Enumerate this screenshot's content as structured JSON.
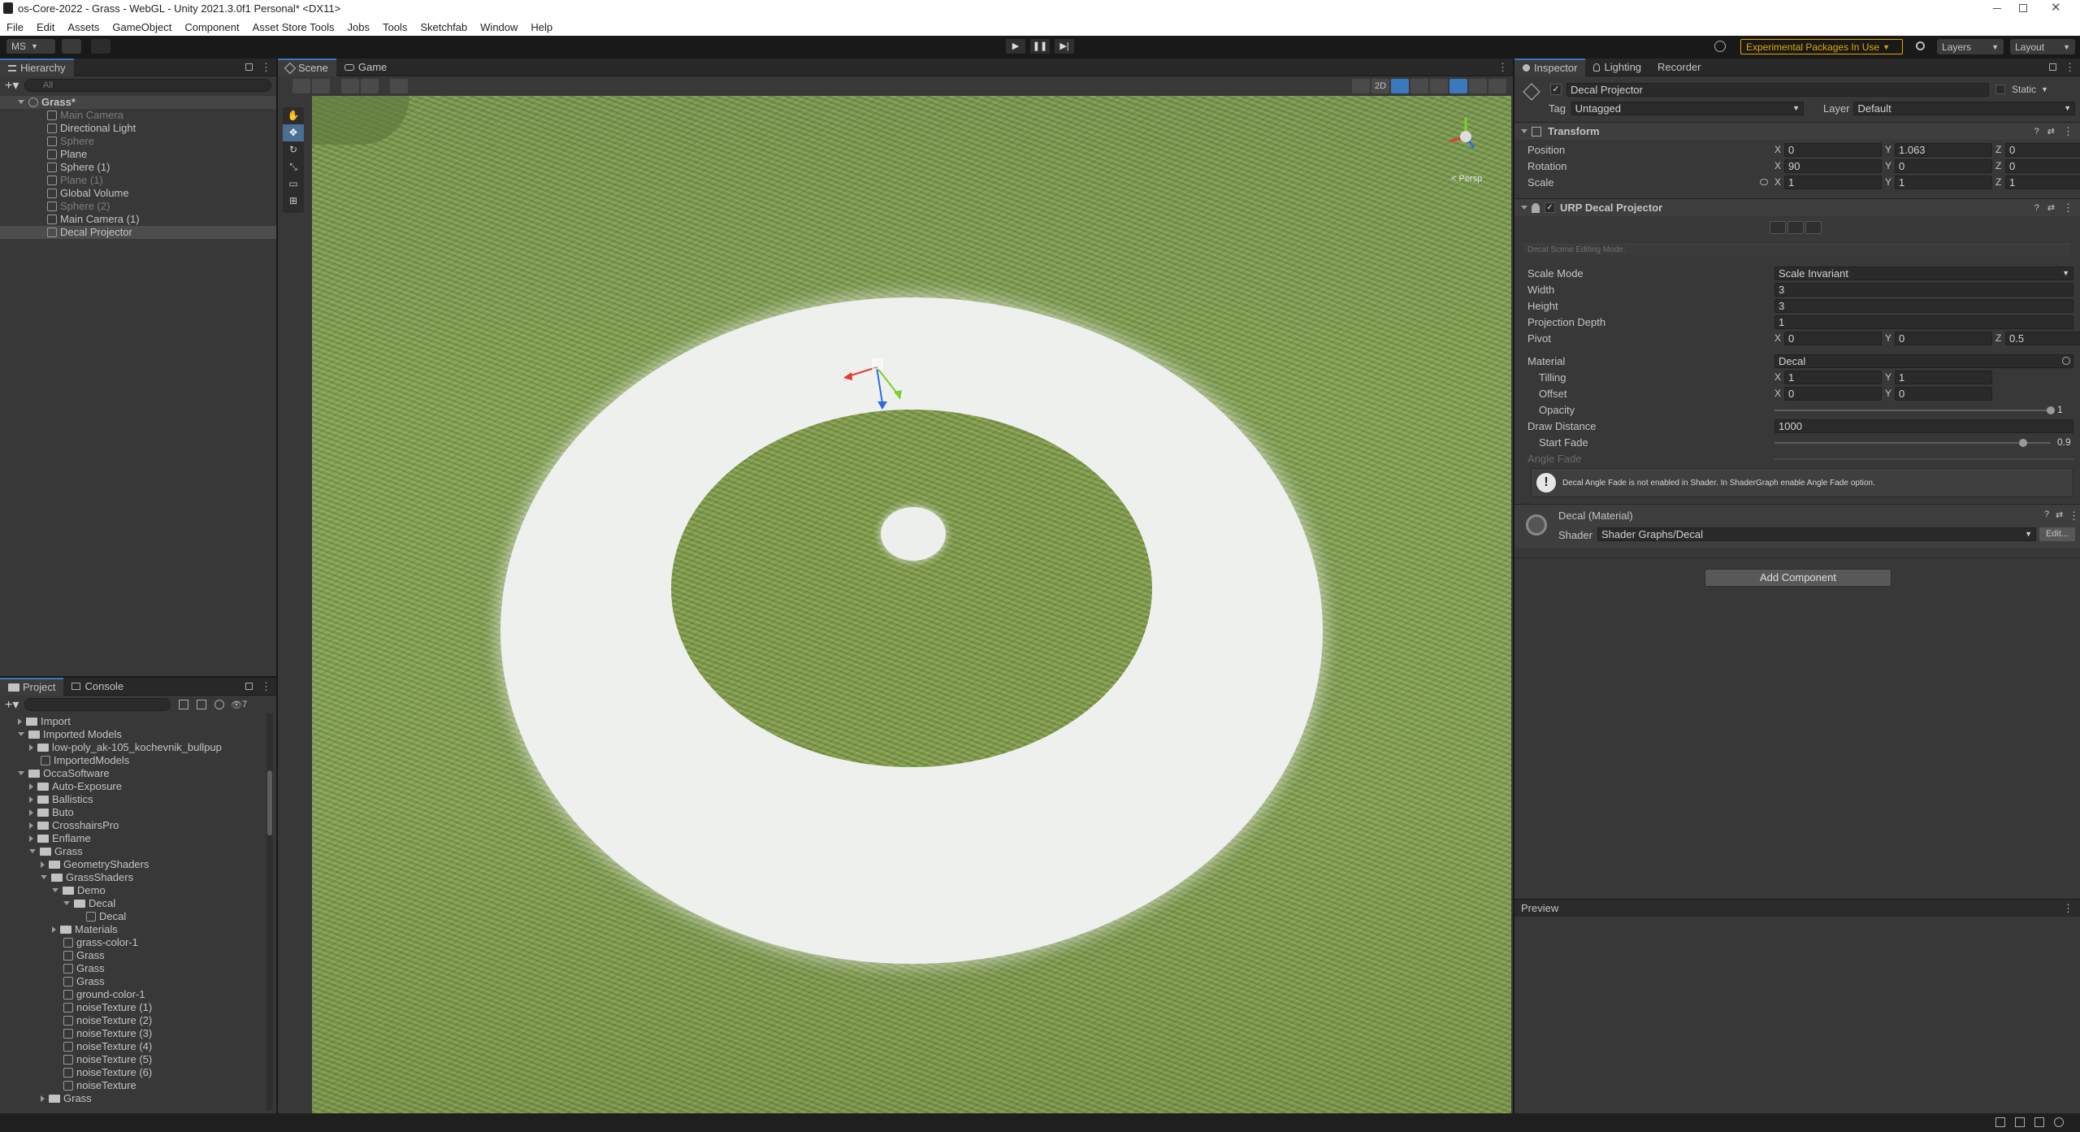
{
  "window": {
    "title": "os-Core-2022 - Grass - WebGL - Unity 2021.3.0f1 Personal* <DX11>"
  },
  "menu": [
    "File",
    "Edit",
    "Assets",
    "GameObject",
    "Component",
    "Asset Store Tools",
    "Jobs",
    "Tools",
    "Sketchfab",
    "Window",
    "Help"
  ],
  "toolbar": {
    "account": "MS",
    "experimental": "Experimental Packages In Use",
    "layers": "Layers",
    "layout": "Layout"
  },
  "hierarchy": {
    "tab": "Hierarchy",
    "search_placeholder": "All",
    "scene": "Grass*",
    "items": [
      {
        "label": "Main Camera",
        "dim": true
      },
      {
        "label": "Directional Light",
        "dim": false
      },
      {
        "label": "Sphere",
        "dim": true
      },
      {
        "label": "Plane",
        "dim": false
      },
      {
        "label": "Sphere (1)",
        "dim": false
      },
      {
        "label": "Plane (1)",
        "dim": true
      },
      {
        "label": "Global Volume",
        "dim": false
      },
      {
        "label": "Sphere (2)",
        "dim": true
      },
      {
        "label": "Main Camera (1)",
        "dim": false
      },
      {
        "label": "Decal Projector",
        "dim": false,
        "selected": true
      }
    ]
  },
  "scene_tabs": {
    "scene": "Scene",
    "game": "Game",
    "toggle_2d": "2D",
    "persp": "< Persp"
  },
  "project": {
    "tab_project": "Project",
    "tab_console": "Console",
    "hidden_count": "7",
    "tree": [
      {
        "label": "Import",
        "depth": 1,
        "type": "folder",
        "open": false
      },
      {
        "label": "Imported Models",
        "depth": 1,
        "type": "folder",
        "open": true
      },
      {
        "label": "low-poly_ak-105_kochevnik_bullpup",
        "depth": 2,
        "type": "folder",
        "open": false
      },
      {
        "label": "ImportedModels",
        "depth": 2,
        "type": "asset"
      },
      {
        "label": "OccaSoftware",
        "depth": 1,
        "type": "folder",
        "open": true
      },
      {
        "label": "Auto-Exposure",
        "depth": 2,
        "type": "folder",
        "open": false
      },
      {
        "label": "Ballistics",
        "depth": 2,
        "type": "folder",
        "open": false
      },
      {
        "label": "Buto",
        "depth": 2,
        "type": "folder",
        "open": false
      },
      {
        "label": "CrosshairsPro",
        "depth": 2,
        "type": "folder",
        "open": false
      },
      {
        "label": "Enflame",
        "depth": 2,
        "type": "folder",
        "open": false
      },
      {
        "label": "Grass",
        "depth": 2,
        "type": "folder",
        "open": true
      },
      {
        "label": "GeometryShaders",
        "depth": 3,
        "type": "folder",
        "open": false
      },
      {
        "label": "GrassShaders",
        "depth": 3,
        "type": "folder",
        "open": true
      },
      {
        "label": "Demo",
        "depth": 4,
        "type": "folder",
        "open": true
      },
      {
        "label": "Decal",
        "depth": 5,
        "type": "folder",
        "open": true
      },
      {
        "label": "Decal",
        "depth": 6,
        "type": "asset"
      },
      {
        "label": "Materials",
        "depth": 4,
        "type": "folder",
        "open": false
      },
      {
        "label": "grass-color-1",
        "depth": 4,
        "type": "asset"
      },
      {
        "label": "Grass",
        "depth": 4,
        "type": "asset"
      },
      {
        "label": "Grass",
        "depth": 4,
        "type": "asset"
      },
      {
        "label": "Grass",
        "depth": 4,
        "type": "asset"
      },
      {
        "label": "ground-color-1",
        "depth": 4,
        "type": "asset"
      },
      {
        "label": "noiseTexture (1)",
        "depth": 4,
        "type": "asset"
      },
      {
        "label": "noiseTexture (2)",
        "depth": 4,
        "type": "asset"
      },
      {
        "label": "noiseTexture (3)",
        "depth": 4,
        "type": "asset"
      },
      {
        "label": "noiseTexture (4)",
        "depth": 4,
        "type": "asset"
      },
      {
        "label": "noiseTexture (5)",
        "depth": 4,
        "type": "asset"
      },
      {
        "label": "noiseTexture (6)",
        "depth": 4,
        "type": "asset"
      },
      {
        "label": "noiseTexture",
        "depth": 4,
        "type": "asset"
      },
      {
        "label": "Grass",
        "depth": 3,
        "type": "folder",
        "open": false
      }
    ]
  },
  "inspector": {
    "tab_inspector": "Inspector",
    "tab_lighting": "Lighting",
    "tab_recorder": "Recorder",
    "object_name": "Decal Projector",
    "static": "Static",
    "tag_label": "Tag",
    "tag_value": "Untagged",
    "layer_label": "Layer",
    "layer_value": "Default",
    "transform": {
      "title": "Transform",
      "position": {
        "label": "Position",
        "x": "0",
        "y": "1.063",
        "z": "0"
      },
      "rotation": {
        "label": "Rotation",
        "x": "90",
        "y": "0",
        "z": "0"
      },
      "scale": {
        "label": "Scale",
        "x": "1",
        "y": "1",
        "z": "1"
      }
    },
    "decal": {
      "title": "URP Decal Projector",
      "editing_mode": "Decal Scene Editing Mode:",
      "scale_mode_label": "Scale Mode",
      "scale_mode": "Scale Invariant",
      "width_label": "Width",
      "width": "3",
      "height_label": "Height",
      "height": "3",
      "depth_label": "Projection Depth",
      "depth": "1",
      "pivot_label": "Pivot",
      "pivot_x": "0",
      "pivot_y": "0",
      "pivot_z": "0.5",
      "material_label": "Material",
      "material": "Decal",
      "tiling_label": "Tilling",
      "tiling_x": "1",
      "tiling_y": "1",
      "offset_label": "Offset",
      "offset_x": "0",
      "offset_y": "0",
      "opacity_label": "Opacity",
      "opacity": "1",
      "draw_distance_label": "Draw Distance",
      "draw_distance": "1000",
      "start_fade_label": "Start Fade",
      "start_fade": "0.9",
      "angle_fade_label": "Angle Fade",
      "warning": "Decal Angle Fade is not enabled in Shader. In ShaderGraph enable Angle Fade option."
    },
    "material": {
      "title": "Decal (Material)",
      "shader_label": "Shader",
      "shader": "Shader Graphs/Decal",
      "edit": "Edit..."
    },
    "add_component": "Add Component",
    "preview": "Preview"
  },
  "axis": {
    "x": "X",
    "y": "Y",
    "z": "Z"
  },
  "colors": {
    "accent": "#3a79bb",
    "warning": "#e0a800",
    "selected": "#4d4d4d"
  }
}
